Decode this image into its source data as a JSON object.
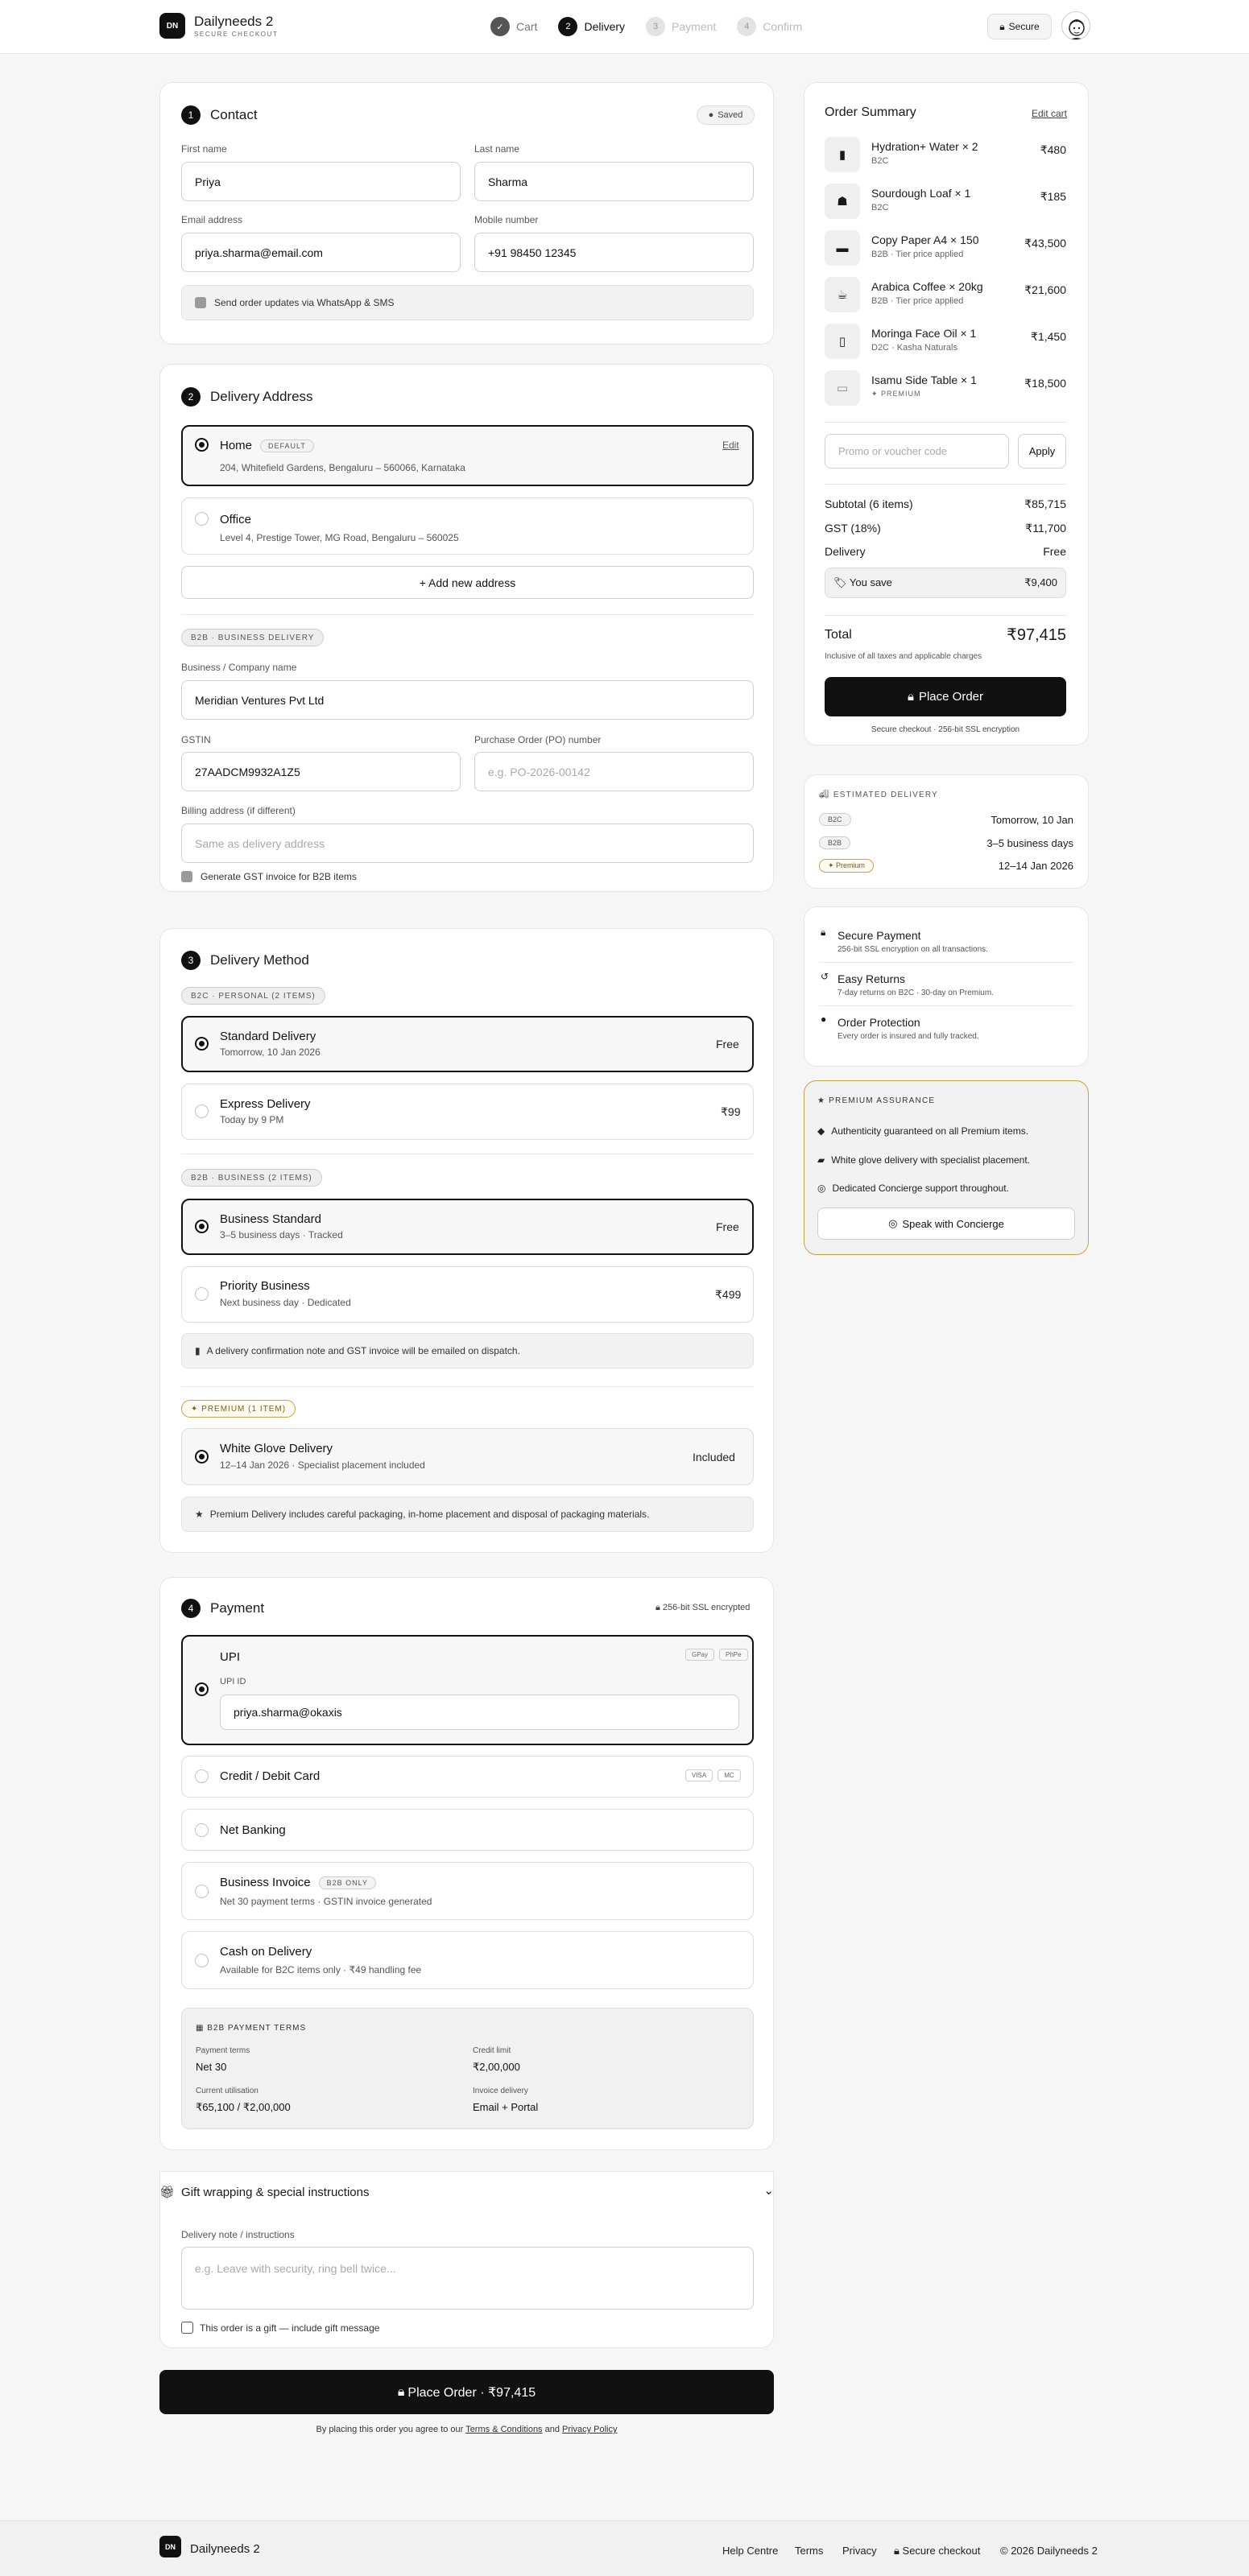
{
  "header": {
    "logo": "DN",
    "brand": "Dailyneeds 2",
    "tagline": "SECURE CHECKOUT",
    "secure": "Secure",
    "steps": [
      {
        "n": "✓",
        "label": "Cart",
        "state": "done"
      },
      {
        "n": "2",
        "label": "Delivery",
        "state": "act"
      },
      {
        "n": "3",
        "label": "Payment",
        "state": "off"
      },
      {
        "n": "4",
        "label": "Confirm",
        "state": "off"
      }
    ]
  },
  "contact": {
    "num": "1",
    "title": "Contact",
    "saved": "Saved",
    "first_label": "First name",
    "first": "Priya",
    "last_label": "Last name",
    "last": "Sharma",
    "email_label": "Email address",
    "email": "priya.sharma@email.com",
    "mobile_label": "Mobile number",
    "mobile": "+91 98450 12345",
    "updates": "Send order updates via WhatsApp & SMS"
  },
  "address": {
    "num": "2",
    "title": "Delivery Address",
    "home": {
      "name": "Home",
      "badge": "DEFAULT",
      "line": "204, Whitefield Gardens, Bengaluru – 560066, Karnataka",
      "edit": "Edit"
    },
    "office": {
      "name": "Office",
      "line": "Level 4, Prestige Tower, MG Road, Bengaluru – 560025"
    },
    "add": "+ Add new address",
    "b2b_tag": "B2B · BUSINESS DELIVERY",
    "company_label": "Business / Company name",
    "company": "Meridian Ventures Pvt Ltd",
    "gstin_label": "GSTIN",
    "gstin": "27AADCM9932A1Z5",
    "po_label": "Purchase Order (PO) number",
    "po_ph": "e.g. PO-2026-00142",
    "billing_label": "Billing address (if different)",
    "billing_ph": "Same as delivery address",
    "gst_invoice": "Generate GST invoice for B2B items"
  },
  "method": {
    "num": "3",
    "title": "Delivery Method",
    "b2c_tag": "B2C · PERSONAL (2 ITEMS)",
    "standard": {
      "t": "Standard Delivery",
      "s": "Tomorrow, 10 Jan 2026",
      "p": "Free"
    },
    "express": {
      "t": "Express Delivery",
      "s": "Today by 9 PM",
      "p": "₹99"
    },
    "b2b_tag": "B2B · BUSINESS (2 ITEMS)",
    "bstd": {
      "t": "Business Standard",
      "s": "3–5 business days · Tracked",
      "p": "Free"
    },
    "prio": {
      "t": "Priority Business",
      "s": "Next business day · Dedicated",
      "p": "₹499"
    },
    "note": "A delivery confirmation note and GST invoice will be emailed on dispatch.",
    "prem_tag": "✦ PREMIUM (1 ITEM)",
    "glove": {
      "t": "White Glove Delivery",
      "s": "12–14 Jan 2026 · Specialist placement included",
      "p": "Included"
    },
    "prem_note": "Premium Delivery includes careful packaging, in-home placement and disposal of packaging materials."
  },
  "payment": {
    "num": "4",
    "title": "Payment",
    "ssl": "256-bit SSL encrypted",
    "upi": {
      "t": "UPI",
      "chips": [
        "GPay",
        "PhPe"
      ],
      "id_label": "UPI ID",
      "id": "priya.sharma@okaxis"
    },
    "card": {
      "t": "Credit / Debit Card",
      "chips": [
        "VISA",
        "MC"
      ]
    },
    "net": {
      "t": "Net Banking"
    },
    "invoice": {
      "t": "Business Invoice",
      "badge": "B2B ONLY",
      "s": "Net 30 payment terms · GSTIN invoice generated"
    },
    "cod": {
      "t": "Cash on Delivery",
      "s": "Available for B2C items only · ₹49 handling fee"
    },
    "terms": {
      "title": "B2B PAYMENT TERMS",
      "pt_label": "Payment terms",
      "pt": "Net 30",
      "cl_label": "Credit limit",
      "cl": "₹2,00,000",
      "cu_label": "Current utilisation",
      "cu": "₹65,100 / ₹2,00,000",
      "id_label": "Invoice delivery",
      "id": "Email + Portal"
    }
  },
  "gift": {
    "title": "Gift wrapping & special instructions",
    "note_label": "Delivery note / instructions",
    "note_ph": "e.g. Leave with security, ring bell twice...",
    "gift_check": "This order is a gift — include gift message"
  },
  "place": {
    "label": "Place Order · ₹97,415",
    "agree_pre": "By placing this order you agree to our ",
    "terms": "Terms & Conditions",
    "and": " and ",
    "privacy": "Privacy Policy"
  },
  "summary": {
    "title": "Order Summary",
    "edit": "Edit cart",
    "items": [
      {
        "name": "Hydration+ Water × 2",
        "sub": "B2C",
        "price": "₹480"
      },
      {
        "name": "Sourdough Loaf × 1",
        "sub": "B2C",
        "price": "₹185"
      },
      {
        "name": "Copy Paper A4 × 150",
        "sub": "B2B · Tier price applied",
        "price": "₹43,500"
      },
      {
        "name": "Arabica Coffee × 20kg",
        "sub": "B2B · Tier price applied",
        "price": "₹21,600"
      },
      {
        "name": "Moringa Face Oil × 1",
        "sub": "D2C · Kasha Naturals",
        "price": "₹1,450"
      },
      {
        "name": "Isamu Side Table × 1",
        "sub": "✦ PREMIUM",
        "price": "₹18,500"
      }
    ],
    "promo_ph": "Promo or voucher code",
    "apply": "Apply",
    "subtotal_l": "Subtotal (6 items)",
    "subtotal": "₹85,715",
    "gst_l": "GST (18%)",
    "gst": "₹11,700",
    "del_l": "Delivery",
    "del": "Free",
    "save_l": "You save",
    "save": "₹9,400",
    "total_l": "Total",
    "total": "₹97,415",
    "incl": "Inclusive of all taxes and applicable charges",
    "place": "Place Order",
    "secure": "Secure checkout · 256-bit SSL encryption"
  },
  "est": {
    "title": "ESTIMATED DELIVERY",
    "rows": [
      {
        "tag": "B2C",
        "v": "Tomorrow, 10 Jan"
      },
      {
        "tag": "B2B",
        "v": "3–5 business days"
      },
      {
        "tag": "✦ Premium",
        "v": "12–14 Jan 2026"
      }
    ]
  },
  "trust": [
    {
      "t": "Secure Payment",
      "s": "256-bit SSL encryption on all transactions."
    },
    {
      "t": "Easy Returns",
      "s": "7-day returns on B2C · 30-day on Premium."
    },
    {
      "t": "Order Protection",
      "s": "Every order is insured and fully tracked."
    }
  ],
  "assurance": {
    "title": "PREMIUM ASSURANCE",
    "rows": [
      "Authenticity guaranteed on all Premium items.",
      "White glove delivery with specialist placement.",
      "Dedicated Concierge support throughout."
    ],
    "btn": "Speak with Concierge"
  },
  "footer": {
    "logo": "DN",
    "brand": "Dailyneeds 2",
    "links": [
      "Help Centre",
      "Terms",
      "Privacy"
    ],
    "secure": "Secure checkout",
    "copy": "© 2026 Dailyneeds 2"
  },
  "colors": {
    "accent": "#111111",
    "gold": "#c8a24a",
    "bg": "#f6f6f6"
  }
}
